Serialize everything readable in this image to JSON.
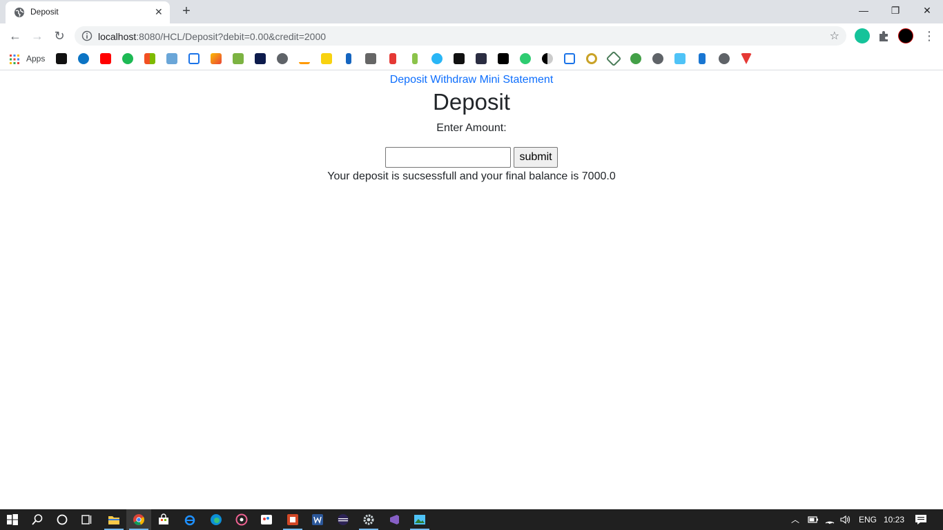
{
  "browser": {
    "tab_title": "Deposit",
    "tab_close": "✕",
    "new_tab": "+",
    "window_controls": {
      "minimize": "—",
      "restore": "❐",
      "close": "✕"
    },
    "nav": {
      "back": "←",
      "forward": "→",
      "reload": "↻"
    },
    "url_host": "localhost",
    "url_path": ":8080/HCL/Deposit?debit=0.00&credit=2000",
    "bookmark_star": "☆",
    "menu": "⋮",
    "apps_label": "Apps"
  },
  "page": {
    "nav_links": [
      "Deposit",
      "Withdraw",
      "Mini Statement"
    ],
    "title": "Deposit",
    "amount_label": "Enter Amount:",
    "amount_value": "",
    "submit_label": "submit",
    "result_message": "Your deposit is sucsessfull and your final balance is 7000.0"
  },
  "taskbar": {
    "language": "ENG",
    "time": "10:23"
  },
  "colors": {
    "link": "#0d6efd",
    "tab_strip": "#dee1e6",
    "taskbar": "#202020"
  }
}
